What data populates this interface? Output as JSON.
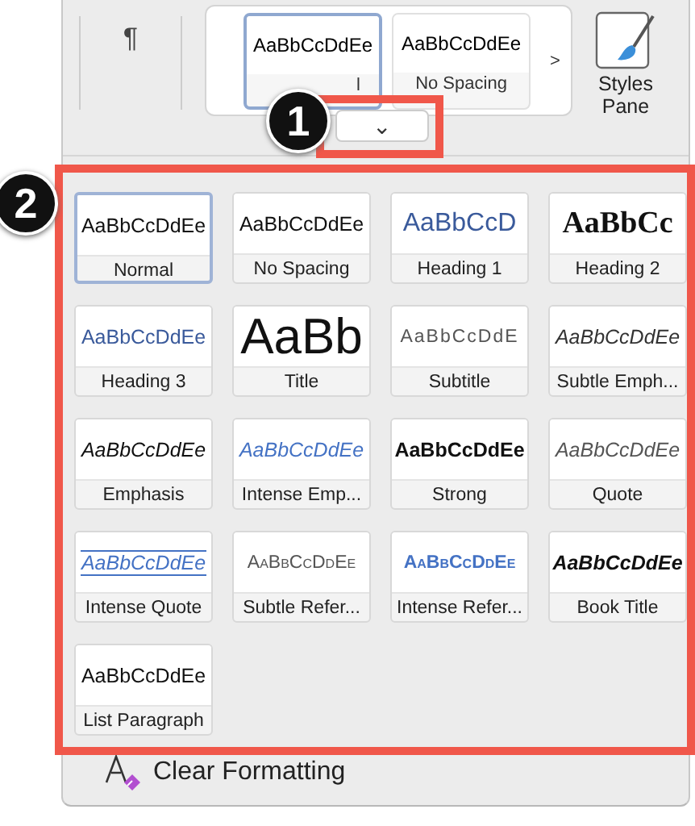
{
  "ribbon": {
    "paragraph_mark": "¶",
    "quick_styles": [
      {
        "preview": "AaBbCcDdEe",
        "label": "l",
        "selected": true
      },
      {
        "preview": "AaBbCcDdEe",
        "label": "No Spacing",
        "selected": false
      }
    ],
    "next_arrow": ">",
    "expand_chevron": "⌄",
    "styles_pane": "Styles Pane"
  },
  "gallery": [
    {
      "preview": "AaBbCcDdEe",
      "label": "Normal",
      "kind": "normal",
      "selected": true
    },
    {
      "preview": "AaBbCcDdEe",
      "label": "No Spacing",
      "kind": "normal",
      "selected": false
    },
    {
      "preview": "AaBbCcD",
      "label": "Heading 1",
      "kind": "heading1",
      "selected": false
    },
    {
      "preview": "AaBbCc",
      "label": "Heading 2",
      "kind": "heading2",
      "selected": false
    },
    {
      "preview": "AaBbCcDdEe",
      "label": "Heading 3",
      "kind": "heading3",
      "selected": false
    },
    {
      "preview": "AaBb",
      "label": "Title",
      "kind": "title",
      "selected": false
    },
    {
      "preview": "AaBbCcDdE",
      "label": "Subtitle",
      "kind": "subtitle",
      "selected": false
    },
    {
      "preview": "AaBbCcDdEe",
      "label": "Subtle Emph...",
      "kind": "subtleemph",
      "selected": false
    },
    {
      "preview": "AaBbCcDdEe",
      "label": "Emphasis",
      "kind": "emphasis",
      "selected": false
    },
    {
      "preview": "AaBbCcDdEe",
      "label": "Intense Emp...",
      "kind": "intenseemph",
      "selected": false
    },
    {
      "preview": "AaBbCcDdEe",
      "label": "Strong",
      "kind": "strong",
      "selected": false
    },
    {
      "preview": "AaBbCcDdEe",
      "label": "Quote",
      "kind": "quote",
      "selected": false
    },
    {
      "preview": "AaBbCcDdEe",
      "label": "Intense Quote",
      "kind": "intensequote",
      "selected": false
    },
    {
      "preview": "AaBbCcDdEe",
      "label": "Subtle Refer...",
      "kind": "subtleref",
      "selected": false
    },
    {
      "preview": "AaBbCcDdEe",
      "label": "Intense Refer...",
      "kind": "intenseref",
      "selected": false
    },
    {
      "preview": "AaBbCcDdEe",
      "label": "Book Title",
      "kind": "booktitle",
      "selected": false
    },
    {
      "preview": "AaBbCcDdEe",
      "label": "List Paragraph",
      "kind": "normal",
      "selected": false
    }
  ],
  "clear_formatting": "Clear Formatting",
  "callouts": [
    {
      "label": "1"
    },
    {
      "label": "2"
    }
  ]
}
